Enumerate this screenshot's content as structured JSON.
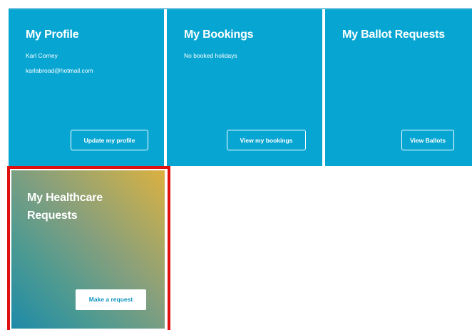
{
  "profile_card": {
    "title": "My Profile",
    "name": "Karl Corney",
    "email": "karlabroad@hotmail.com",
    "button_label": "Update my profile"
  },
  "bookings_card": {
    "title": "My Bookings",
    "status": "No booked holidays",
    "button_label": "View my bookings"
  },
  "ballots_card": {
    "title": "My Ballot Requests",
    "button_label": "View Ballots"
  },
  "healthcare_card": {
    "title": "My Healthcare Requests",
    "button_label": "Make a request"
  },
  "colors": {
    "card_blue": "#07a6d2",
    "highlight_red": "#e01010",
    "gradient_top": "#dcb040",
    "gradient_bottom": "#1e8aa8",
    "request_button_text": "#1295c1"
  }
}
